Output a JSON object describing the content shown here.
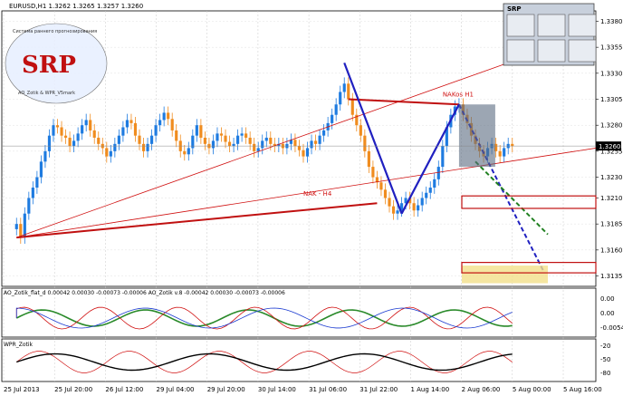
{
  "chart_data": {
    "type": "candlestick",
    "header": "EURUSD,H1  1.3262 1.3265 1.3257 1.3260",
    "symbol": "EURUSD,H1",
    "ohlc": {
      "open": 1.3262,
      "high": 1.3265,
      "low": 1.3257,
      "close": 1.326
    },
    "current_price_label": "1.3260",
    "ylim": [
      1.3125,
      1.339
    ],
    "y_ticks": [
      "1.3380",
      "1.3355",
      "1.3330",
      "1.3305",
      "1.3280",
      "1.3255",
      "1.3230",
      "1.3210",
      "1.3185",
      "1.3160",
      "1.3135"
    ],
    "x_ticks": [
      "25 Jul 2013",
      "25 Jul 20:00",
      "26 Jul 12:00",
      "29 Jul 04:00",
      "29 Jul 20:00",
      "30 Jul 14:00",
      "31 Jul 06:00",
      "31 Jul 22:00",
      "1 Aug 14:00",
      "2 Aug 06:00",
      "5 Aug 00:00",
      "5 Aug 16:00"
    ],
    "bar_colors": {
      "up": "#1e7be0",
      "down": "#f08c1e"
    },
    "closes": [
      1.3185,
      1.3172,
      1.3195,
      1.321,
      1.322,
      1.323,
      1.3245,
      1.3255,
      1.327,
      1.328,
      1.3278,
      1.327,
      1.3268,
      1.326,
      1.3265,
      1.3272,
      1.328,
      1.3285,
      1.3275,
      1.3268,
      1.3262,
      1.3258,
      1.325,
      1.3255,
      1.3262,
      1.327,
      1.3278,
      1.3285,
      1.3282,
      1.327,
      1.3262,
      1.3255,
      1.3262,
      1.327,
      1.328,
      1.3285,
      1.3292,
      1.3286,
      1.3275,
      1.3265,
      1.3255,
      1.3252,
      1.3258,
      1.327,
      1.328,
      1.3268,
      1.3262,
      1.3258,
      1.3265,
      1.3272,
      1.327,
      1.3264,
      1.326,
      1.3262,
      1.327,
      1.3272,
      1.3268,
      1.3262,
      1.3255,
      1.3258,
      1.3265,
      1.3268,
      1.3262,
      1.326,
      1.3262,
      1.3258,
      1.3262,
      1.3266,
      1.326,
      1.3256,
      1.325,
      1.3258,
      1.3265,
      1.3262,
      1.327,
      1.3275,
      1.3282,
      1.329,
      1.33,
      1.3312,
      1.332,
      1.3305,
      1.329,
      1.328,
      1.327,
      1.3255,
      1.324,
      1.323,
      1.3225,
      1.3218,
      1.321,
      1.3202,
      1.3195,
      1.3198,
      1.3205,
      1.321,
      1.3205,
      1.3198,
      1.3203,
      1.321,
      1.3215,
      1.322,
      1.3228,
      1.324,
      1.326,
      1.3278,
      1.329,
      1.3298,
      1.33,
      1.329,
      1.3282,
      1.327,
      1.3262,
      1.3255,
      1.325,
      1.3258,
      1.3262,
      1.3255,
      1.325,
      1.3258,
      1.3262,
      1.326
    ],
    "labels": [
      "NAKos H1",
      "NAK - H4"
    ],
    "indicator_1": {
      "label": "AO_Zotik_flat_d 0.00042 0.00030 -0.00073 -0.00006 AO_Zotik v.8 -0.00042 0.00030 -0.00073 -0.00006",
      "y_ticks": [
        "0.00",
        "0.00",
        "-0.00542"
      ]
    },
    "indicator_2": {
      "label": "WPR_Zotik",
      "y_ticks": [
        "-20",
        "-50",
        "-80"
      ]
    },
    "logo": {
      "text": "SRP",
      "ring_text": "Система раннего прогнозирования",
      "sub_text": "AO_Zotik & WPR_V5mark"
    },
    "panel": {
      "title": "SRP"
    }
  }
}
